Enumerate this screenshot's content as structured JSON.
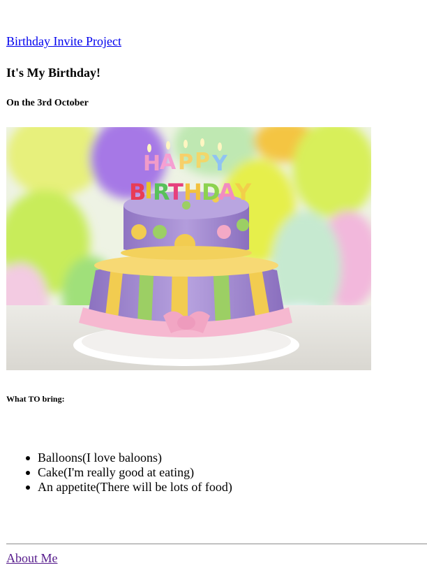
{
  "nav": {
    "project_link": "Birthday Invite Project"
  },
  "header": {
    "title": "It's My Birthday!",
    "subtitle": "On the 3rd October"
  },
  "hero": {
    "cake_lettering": "HAPPY BIRTHDAY",
    "colors": {
      "balloon_purple": "#a678e6",
      "balloon_yellow": "#e6f04a",
      "balloon_lime": "#c8ec5a",
      "balloon_pink": "#f2b8dc",
      "cake_purple": "#a58bd0",
      "stripe_yellow": "#f2cc50",
      "stripe_green": "#9ccf64",
      "ribbon_pink": "#f6b8d0"
    }
  },
  "bring": {
    "heading": "What TO bring:",
    "items": [
      "Balloons(I love baloons)",
      "Cake(I'm really good at eating)",
      "An appetite(There will be lots of food)"
    ]
  },
  "footer": {
    "about_link": "About Me"
  },
  "colors": {
    "link": "#0000ee",
    "visited_link": "#551a8b",
    "divider": "#9a9a9a"
  }
}
